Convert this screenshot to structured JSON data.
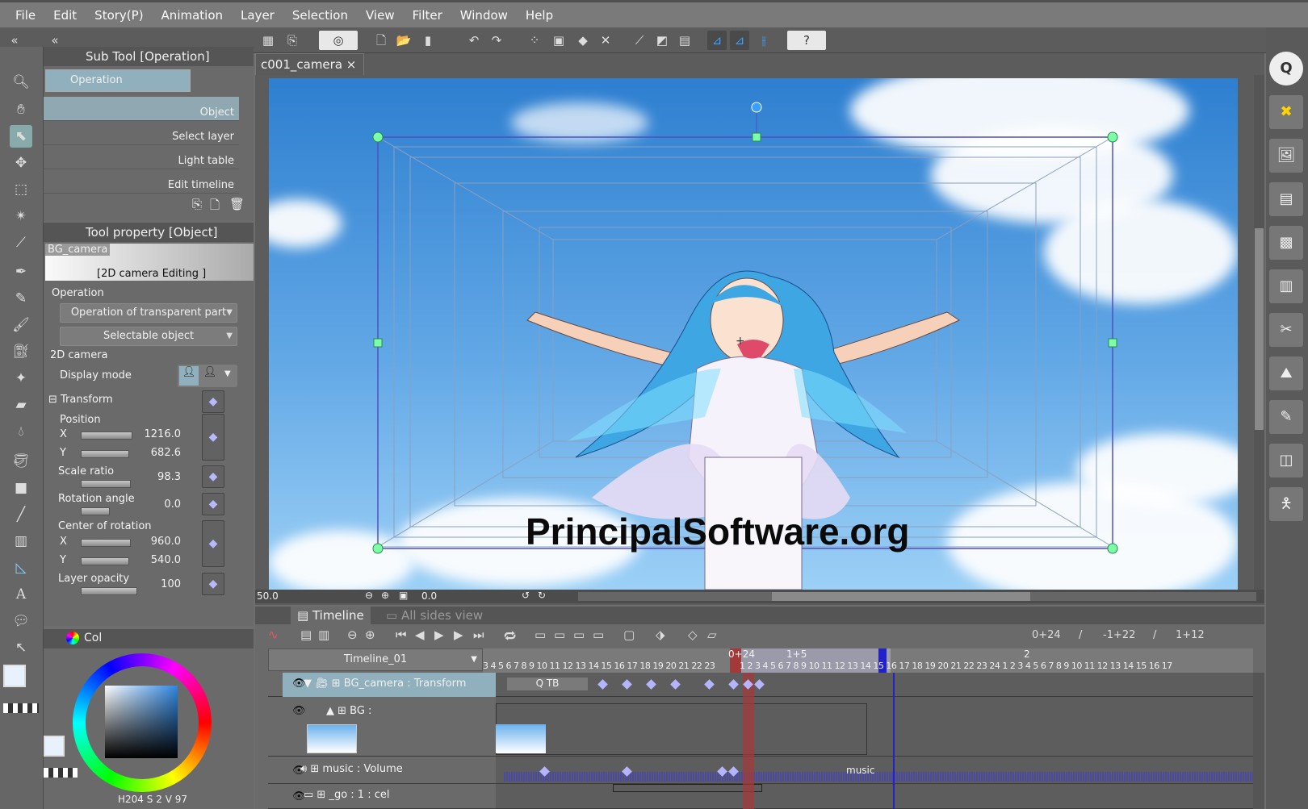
{
  "menu": [
    "File",
    "Edit",
    "Story(P)",
    "Animation",
    "Layer",
    "Selection",
    "View",
    "Filter",
    "Window",
    "Help"
  ],
  "document_tab": {
    "title": "c001_camera",
    "close": "×"
  },
  "sub_tool": {
    "title": "Sub Tool [Operation]",
    "group": "Operation",
    "items": [
      "Object",
      "Select layer",
      "Light table",
      "Edit timeline"
    ],
    "selected": "Object"
  },
  "tool_property": {
    "title": "Tool property [Object]",
    "preview_name": "BG_camera",
    "preview_caption": "[2D camera Editing ]",
    "section_operation": "Operation",
    "transparent_dropdown": "Operation of transparent part",
    "selectable_dropdown": "Selectable object",
    "section_camera": "2D camera",
    "display_mode_label": "Display mode",
    "transform": "Transform",
    "position": "Position",
    "x_label": "X",
    "y_label": "Y",
    "pos_x": "1216.0",
    "pos_y": "682.6",
    "scale_label": "Scale ratio",
    "scale": "98.3",
    "rotation_label": "Rotation angle",
    "rotation": "0.0",
    "center_label": "Center of rotation",
    "center_x": "960.0",
    "center_y": "540.0",
    "opacity_label": "Layer opacity",
    "opacity": "100"
  },
  "color_panel": {
    "tab": "Col",
    "h": "204",
    "s": "2",
    "v": "97",
    "h_label": "H",
    "s_label": "S",
    "v_label": "V",
    "accent": "#1b2c45"
  },
  "canvas": {
    "watermark": "PrincipalSoftware.org",
    "zoom": "50.0",
    "rotation": "0.0"
  },
  "timeline": {
    "tab": "Timeline",
    "tab2": "All sides view",
    "name": "Timeline_01",
    "time_readouts": [
      "0+24",
      "/",
      "-1+22",
      "/",
      "1+12"
    ],
    "current_frame": "0+24",
    "marker_1": "1+5",
    "marker_2": "2",
    "ruler_before": "3 4 5 6 7 8 9 10 11 12 13 14 15 16 17 18 19 20 21 22 23",
    "ruler_after": "1 2 3 4 5 6 7 8 9 10 11 12 13 14 15 16 17 18 19 20 21 22 23 24 1 2 3 4 5 6 7 8 9 10 11 12 13 14 15 16 17",
    "tracks": [
      {
        "name": "BG_camera : Transform",
        "clip": "Q TB"
      },
      {
        "name": "BG :"
      },
      {
        "name": "music : Volume",
        "clip": "music"
      },
      {
        "name": "_go : 1 : cel"
      }
    ]
  },
  "colors": {
    "accent": "#b4b4ff",
    "playhead": "#a33a3a",
    "end_marker": "#2222c8"
  }
}
